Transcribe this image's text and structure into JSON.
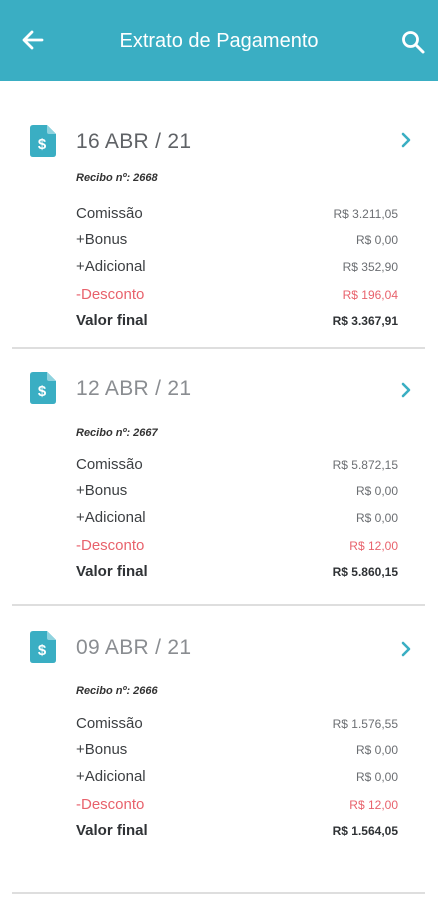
{
  "header": {
    "title": "Extrato de Pagamento",
    "back_icon": "arrow-left-icon",
    "search_icon": "search-icon",
    "background": "#3aaec3"
  },
  "statements": [
    {
      "date": "16 ABR / 21",
      "receipt": "Recibo nº: 2668",
      "rows": [
        {
          "label": "Comissão",
          "value": "R$ 3.211,05"
        },
        {
          "label": "+Bonus",
          "value": "R$ 0,00"
        },
        {
          "label": "+Adicional",
          "value": "R$ 352,90"
        },
        {
          "label": "-Desconto",
          "value": "R$ 196,04"
        },
        {
          "label": "Valor final",
          "value": "R$ 3.367,91"
        }
      ]
    },
    {
      "date": "12 ABR / 21",
      "receipt": "Recibo nº: 2667",
      "rows": [
        {
          "label": "Comissão",
          "value": "R$ 5.872,15"
        },
        {
          "label": "+Bonus",
          "value": "R$ 0,00"
        },
        {
          "label": "+Adicional",
          "value": "R$ 0,00"
        },
        {
          "label": "-Desconto",
          "value": "R$ 12,00"
        },
        {
          "label": "Valor final",
          "value": "R$ 5.860,15"
        }
      ]
    },
    {
      "date": "09 ABR / 21",
      "receipt": "Recibo nº: 2666",
      "rows": [
        {
          "label": "Comissão",
          "value": "R$ 1.576,55"
        },
        {
          "label": "+Bonus",
          "value": "R$ 0,00"
        },
        {
          "label": "+Adicional",
          "value": "R$ 0,00"
        },
        {
          "label": "-Desconto",
          "value": "R$ 12,00"
        },
        {
          "label": "Valor final",
          "value": "R$ 1.564,05"
        }
      ]
    }
  ],
  "colors": {
    "accent": "#3aaec3",
    "discount": "#e8626c",
    "divider": "#dedede"
  }
}
